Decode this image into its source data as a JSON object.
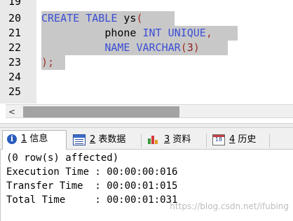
{
  "editor": {
    "line_numbers": [
      "19",
      "20",
      "21",
      "22",
      "23",
      "24",
      "25"
    ],
    "line20": {
      "kw1": "CREATE",
      "kw2": "TABLE",
      "name": "ys",
      "paren": "("
    },
    "line21": {
      "col": "phone",
      "type": "INT",
      "constraint": "UNIQUE",
      "comma": ","
    },
    "line22": {
      "col": "NAME",
      "type": "VARCHAR",
      "open": "(",
      "size": "3",
      "close": ")"
    },
    "line23": {
      "end": ");"
    }
  },
  "scrollbar": {
    "left_arrow": "<"
  },
  "tabs": [
    {
      "icon": "info-icon",
      "num": "1",
      "label": "信息",
      "active": true
    },
    {
      "icon": "table-data-icon",
      "num": "2",
      "label": "表数据"
    },
    {
      "icon": "resources-icon",
      "num": "3",
      "label": "资料"
    },
    {
      "icon": "history-icon",
      "num": "4",
      "label": "历史"
    }
  ],
  "info_icon_glyph": "i",
  "history_icon_glyph": "18",
  "output": {
    "lines": [
      "(0 row(s) affected)",
      "Execution Time : 00:00:00:016",
      "Transfer Time  : 00:00:01:015",
      "Total Time     : 00:00:01:031"
    ]
  },
  "watermark": "https://blog.csdn.net/ifubing",
  "colors": {
    "keyword": "#3b4fd4",
    "selection": "#c8c8c8",
    "gutter": "#e9e9e9"
  }
}
